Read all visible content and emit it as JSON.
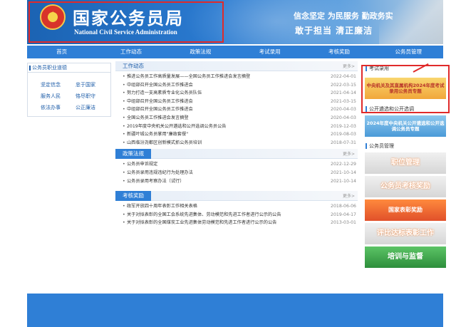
{
  "header": {
    "logo_cn": "国家公务员局",
    "logo_en": "National Civil Service Administration",
    "slogan_line1": "信念坚定  为民服务  勤政务实",
    "slogan_line2": "敢于担当    清正廉洁"
  },
  "nav": {
    "items": [
      "首页",
      "工作动态",
      "政策法规",
      "考试录用",
      "考核奖励",
      "公务员管理"
    ]
  },
  "left": {
    "title": "公务员职业道德",
    "duties": [
      "坚定信念",
      "忠于国家",
      "服务人民",
      "恪尽职守",
      "依法办事",
      "公正廉洁"
    ]
  },
  "work": {
    "title": "工作动态",
    "more": "更多>",
    "items": [
      {
        "title": "推进公务员工作高质量发展——全国公务员工作推进会发言摘登",
        "date": "2022-04-01"
      },
      {
        "title": "中组部召开全国公务员工作推进会",
        "date": "2022-03-15"
      },
      {
        "title": "努力打造一支高素质专业化公务员队伍",
        "date": "2021-04-14"
      },
      {
        "title": "中组部召开全国公务员工作推进会",
        "date": "2021-03-15"
      },
      {
        "title": "中组部召开全国公务员工作推进会",
        "date": "2020-04-03"
      },
      {
        "title": "全国公务员工作推进会发言摘登",
        "date": "2020-04-03"
      },
      {
        "title": "2019年度中央机关公开遴选和公开选调公务员公告",
        "date": "2019-12-03"
      },
      {
        "title": "新疆叶城公务员掌用\"廉政套餐\"",
        "date": "2019-08-03"
      },
      {
        "title": "山西临汾尧都区创新模式抓公务员培训",
        "date": "2018-07-31"
      }
    ]
  },
  "policy": {
    "title": "政策法规",
    "more": "更多>",
    "items": [
      {
        "title": "公务员申诉规定",
        "date": "2022-12-29"
      },
      {
        "title": "公务员录用违规违纪行为处理办法",
        "date": "2021-10-14"
      },
      {
        "title": "公务员录用考察办法（试行）",
        "date": "2021-10-14"
      }
    ]
  },
  "reward": {
    "title": "考核奖励",
    "more": "更多>",
    "items": [
      {
        "title": "政军开放四十周年表彰工作相关表格",
        "date": "2018-06-06"
      },
      {
        "title": "关于对拟表彰的全国工会系统先进集体、劳动模范和先进工作者进行公示的公告",
        "date": "2019-04-17"
      },
      {
        "title": "关于对拟表彰的全国煤炭工业先进集体劳动模范和先进工作者进行公示的公告",
        "date": "2013-03-01"
      }
    ]
  },
  "right": {
    "exam_title": "考试录用",
    "exam_banner": "中央机关及其直属机构2024年度考试录用公务员专题",
    "select_title": "公开遴选和公开选调",
    "select_banner": "2024年度中央机关公开遴选和公开选调公务员专题",
    "mgmt_title": "公务员管理",
    "mgmt_banners": [
      "职位管理",
      "公务员考核奖励",
      "国家表彰奖励",
      "评比达标表彰工作",
      "培训与监督"
    ]
  },
  "colors": {
    "nav_blue": "#2f7fd6",
    "header_blue": "#1b63b3",
    "highlight_red": "#e02a2a"
  }
}
